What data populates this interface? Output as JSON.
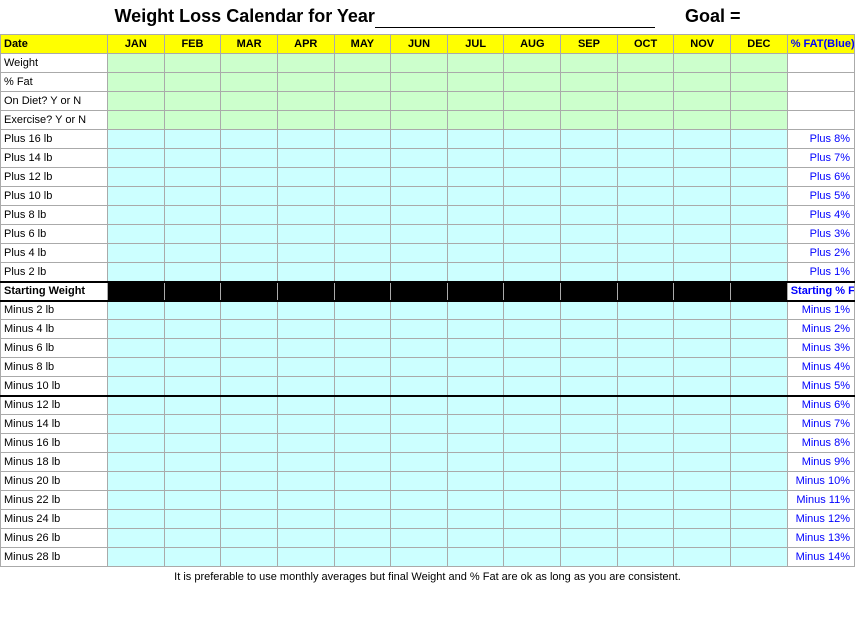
{
  "title": "Weight Loss Calendar for Year",
  "goal_label": "Goal =",
  "footer": "It is preferable to use monthly averages but final Weight and % Fat are ok as long as you are consistent.",
  "header": {
    "date": "Date",
    "months": [
      "JAN",
      "FEB",
      "MAR",
      "APR",
      "MAY",
      "JUN",
      "JUL",
      "AUG",
      "SEP",
      "OCT",
      "NOV",
      "DEC"
    ],
    "fat": "% FAT(Blue)"
  },
  "rows": [
    {
      "label": "Weight",
      "fat": ""
    },
    {
      "label": "% Fat",
      "fat": ""
    },
    {
      "label": "On Diet? Y or N",
      "fat": ""
    },
    {
      "label": "Exercise? Y or N",
      "fat": ""
    },
    {
      "label": "Plus 16 lb",
      "fat": "Plus 8%"
    },
    {
      "label": "Plus 14 lb",
      "fat": "Plus 7%"
    },
    {
      "label": "Plus 12 lb",
      "fat": "Plus 6%"
    },
    {
      "label": "Plus 10 lb",
      "fat": "Plus 5%"
    },
    {
      "label": "Plus 8 lb",
      "fat": "Plus 4%"
    },
    {
      "label": "Plus 6 lb",
      "fat": "Plus 3%"
    },
    {
      "label": "Plus 4 lb",
      "fat": "Plus 2%"
    },
    {
      "label": "Plus 2 lb",
      "fat": "Plus 1%"
    },
    {
      "label": "Starting Weight",
      "fat": "Starting % Fat",
      "is_starting": true
    },
    {
      "label": "Minus 2 lb",
      "fat": "Minus 1%"
    },
    {
      "label": "Minus 4 lb",
      "fat": "Minus 2%"
    },
    {
      "label": "Minus 6 lb",
      "fat": "Minus 3%"
    },
    {
      "label": "Minus 8 lb",
      "fat": "Minus 4%"
    },
    {
      "label": "Minus 10 lb",
      "fat": "Minus 5%",
      "thick_bottom": true
    },
    {
      "label": "Minus 12 lb",
      "fat": "Minus 6%"
    },
    {
      "label": "Minus 14 lb",
      "fat": "Minus 7%"
    },
    {
      "label": "Minus 16 lb",
      "fat": "Minus 8%"
    },
    {
      "label": "Minus 18 lb",
      "fat": "Minus 9%"
    },
    {
      "label": "Minus 20 lb",
      "fat": "Minus 10%"
    },
    {
      "label": "Minus 22 lb",
      "fat": "Minus 11%"
    },
    {
      "label": "Minus 24 lb",
      "fat": "Minus 12%"
    },
    {
      "label": "Minus 26 lb",
      "fat": "Minus 13%"
    },
    {
      "label": "Minus 28 lb",
      "fat": "Minus 14%"
    }
  ]
}
